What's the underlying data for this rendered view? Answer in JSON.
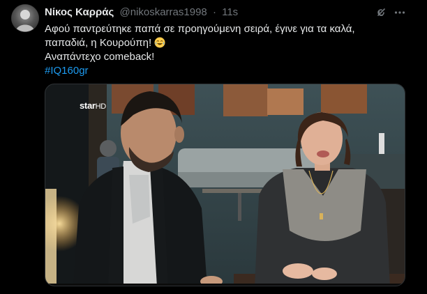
{
  "tweet": {
    "author_name": "Νίκος Καρράς",
    "handle": "@nikoskarras1998",
    "separator": "·",
    "time": "11s",
    "line1": "Αφού παντρεύτηκε παπά σε προηγούμενη σειρά, έγινε για τα καλά,",
    "line2": "παπαδιά, η Κουρούπη!",
    "line3": "Αναπάντεχο comeback!",
    "hashtag": "#IQ160gr",
    "emoji": "joy-face-emoji"
  },
  "media": {
    "channel_logo": "star",
    "channel_logo_suffix": "HD"
  },
  "icons": {
    "grok": "grok-icon",
    "more": "more-icon"
  },
  "colors": {
    "background": "#000000",
    "text": "#e7e9ea",
    "secondary": "#71767b",
    "link": "#1d9bf0"
  }
}
